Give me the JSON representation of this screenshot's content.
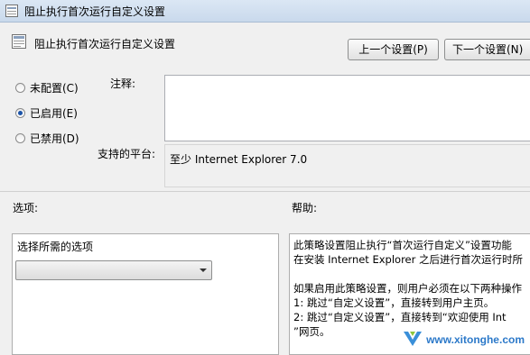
{
  "window": {
    "title": "阻止执行首次运行自定义设置"
  },
  "header": {
    "title": "阻止执行首次运行自定义设置"
  },
  "nav": {
    "prev_label": "上一个设置(P)",
    "next_label": "下一个设置(N)"
  },
  "state": {
    "options": [
      {
        "label": "未配置(C)",
        "selected": false
      },
      {
        "label": "已启用(E)",
        "selected": true
      },
      {
        "label": "已禁用(D)",
        "selected": false
      }
    ]
  },
  "comment": {
    "label": "注释:",
    "value": ""
  },
  "platform": {
    "label": "支持的平台:",
    "value": "至少 Internet Explorer 7.0"
  },
  "options_section": {
    "label": "选项:",
    "choose_label": "选择所需的选项",
    "dropdown_value": ""
  },
  "help_section": {
    "label": "帮助:",
    "lines": [
      "此策略设置阻止执行“首次运行自定义”设置功能",
      "在安装 Internet Explorer 之后进行首次运行时所",
      "",
      "如果启用此策略设置，则用户必须在以下两种操作",
      "1: 跳过“自定义设置”，直接转到用户主页。",
      "2: 跳过“自定义设置”，直接转到“欢迎使用 Int",
      "”网页。"
    ]
  },
  "watermark": {
    "text": "www.xitonghe.com"
  },
  "colors": {
    "accent": "#1b53a8",
    "titlebar": "#c9d9ec",
    "watermark": "#2c79c9"
  }
}
